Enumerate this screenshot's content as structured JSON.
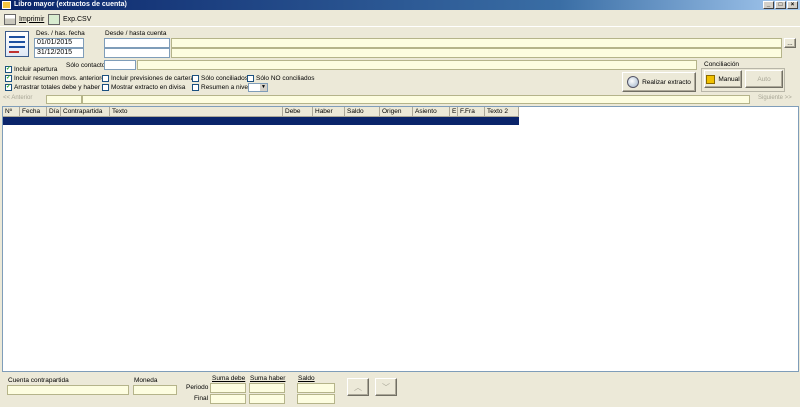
{
  "window": {
    "title": "Libro mayor (extractos de cuenta)"
  },
  "toolbar": {
    "print_label": "Imprimir",
    "export_label": "Exp.CSV"
  },
  "dates": {
    "header": "Des. / has. fecha",
    "from": "01/01/2015",
    "to": "31/12/2015"
  },
  "accounts": {
    "header": "Desde / hasta cuenta",
    "from_code": "",
    "from_name": "",
    "to_code": "",
    "to_name": "",
    "browse": "..."
  },
  "contact": {
    "label": "Sólo contacto",
    "code": "",
    "name": ""
  },
  "options": [
    {
      "label": "Incluir apertura",
      "checked": true
    },
    {
      "label": "Incluir resumen movs. anteriores",
      "checked": true
    },
    {
      "label": "Arrastrar totales debe y haber",
      "checked": true
    },
    {
      "label": "Incluir previsiones de cartera",
      "checked": false
    },
    {
      "label": "Mostrar extracto en divisa",
      "checked": false
    },
    {
      "label": "Sólo conciliados",
      "checked": false
    },
    {
      "label": "Resumen a nivel",
      "checked": false
    },
    {
      "label": "Sólo NO conciliados",
      "checked": false
    }
  ],
  "actions": {
    "run_label": "Realizar extracto"
  },
  "conciliacion": {
    "header": "Conciliación",
    "manual_label": "Manual",
    "auto_label": "Auto"
  },
  "nav": {
    "prev_label": "<< Anterior",
    "next_label": "Siguiente >>"
  },
  "grid": {
    "columns": [
      "Nº",
      "Fecha",
      "Día",
      "Contrapartida",
      "Texto",
      "Debe",
      "Haber",
      "Saldo",
      "Origen",
      "Asiento",
      "E",
      "F.Fra",
      "Texto 2"
    ]
  },
  "footer": {
    "contrapartida_label": "Cuenta contrapartida",
    "moneda_label": "Moneda",
    "suma_debe_label": "Suma debe",
    "suma_haber_label": "Suma haber",
    "saldo_label": "Saldo",
    "periodo_label": "Periodo",
    "final_label": "Final"
  }
}
